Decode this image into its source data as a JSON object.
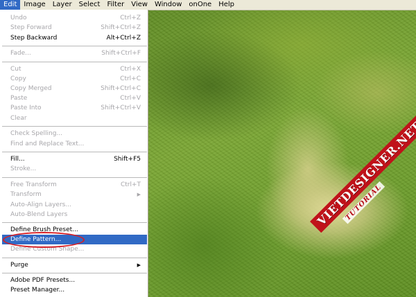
{
  "menubar": {
    "items": [
      "Edit",
      "Image",
      "Layer",
      "Select",
      "Filter",
      "View",
      "Window",
      "onOne",
      "Help"
    ]
  },
  "edit_menu": {
    "items": [
      {
        "label": "Undo",
        "shortcut": "Ctrl+Z",
        "enabled": false
      },
      {
        "label": "Step Forward",
        "shortcut": "Shift+Ctrl+Z",
        "enabled": false
      },
      {
        "label": "Step Backward",
        "shortcut": "Alt+Ctrl+Z",
        "enabled": true
      },
      {
        "label": "Fade...",
        "shortcut": "Shift+Ctrl+F",
        "enabled": false
      },
      {
        "label": "Cut",
        "shortcut": "Ctrl+X",
        "enabled": false
      },
      {
        "label": "Copy",
        "shortcut": "Ctrl+C",
        "enabled": false
      },
      {
        "label": "Copy Merged",
        "shortcut": "Shift+Ctrl+C",
        "enabled": false
      },
      {
        "label": "Paste",
        "shortcut": "Ctrl+V",
        "enabled": false
      },
      {
        "label": "Paste Into",
        "shortcut": "Shift+Ctrl+V",
        "enabled": false
      },
      {
        "label": "Clear",
        "shortcut": "",
        "enabled": false
      },
      {
        "label": "Check Spelling...",
        "shortcut": "",
        "enabled": false
      },
      {
        "label": "Find and Replace Text...",
        "shortcut": "",
        "enabled": false
      },
      {
        "label": "Fill...",
        "shortcut": "Shift+F5",
        "enabled": true
      },
      {
        "label": "Stroke...",
        "shortcut": "",
        "enabled": false
      },
      {
        "label": "Free Transform",
        "shortcut": "Ctrl+T",
        "enabled": false
      },
      {
        "label": "Transform",
        "shortcut": "",
        "enabled": false,
        "submenu": true
      },
      {
        "label": "Auto-Align Layers...",
        "shortcut": "",
        "enabled": false
      },
      {
        "label": "Auto-Blend Layers",
        "shortcut": "",
        "enabled": false
      },
      {
        "label": "Define Brush Preset...",
        "shortcut": "",
        "enabled": true
      },
      {
        "label": "Define Pattern...",
        "shortcut": "",
        "enabled": true,
        "selected": true
      },
      {
        "label": "Define Custom Shape...",
        "shortcut": "",
        "enabled": false
      },
      {
        "label": "Purge",
        "shortcut": "",
        "enabled": true,
        "submenu": true
      },
      {
        "label": "Adobe PDF Presets...",
        "shortcut": "",
        "enabled": true
      },
      {
        "label": "Preset Manager...",
        "shortcut": "",
        "enabled": true
      }
    ],
    "submenu_glyph": "▶"
  },
  "watermark": {
    "main": "VIETDESIGNER.NET",
    "sub": "TUTORIAL"
  },
  "colors": {
    "menu_highlight": "#316ac5",
    "annotation_circle": "#d61f25",
    "watermark_red": "#c0121a"
  }
}
